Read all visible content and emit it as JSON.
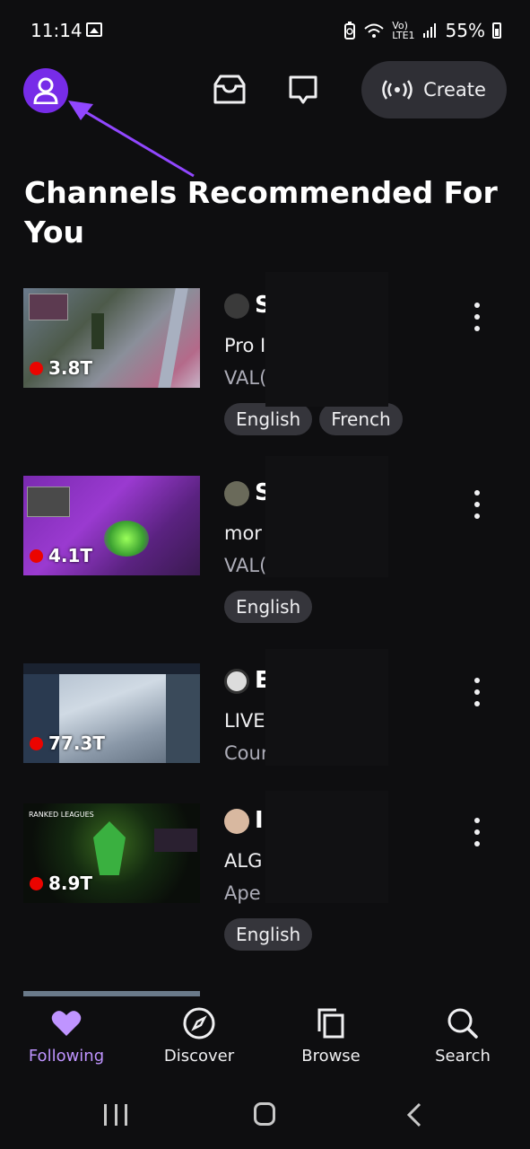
{
  "status_bar": {
    "time": "11:14",
    "network_top": "Vo)",
    "network_bottom": "LTE1",
    "battery": "55%"
  },
  "header": {
    "create_label": "Create"
  },
  "section_title": "Channels Recommended For You",
  "channels": [
    {
      "viewers": "3.8T",
      "name": "S",
      "title": "Pro I                    ER ...",
      "game": "VAL(",
      "tags": [
        "English",
        "French"
      ]
    },
    {
      "viewers": "4.1T",
      "name": "S",
      "title": "mor                     of r...",
      "game": "VAL(",
      "tags": [
        "English"
      ]
    },
    {
      "viewers": "77.3T",
      "name": "E                 )",
      "title": "LIVE                    vs ...",
      "game": "Cour                   Glo...",
      "tags": []
    },
    {
      "viewers": "8.9T",
      "name": "I",
      "title": "ALG                  TY L...",
      "game": "Ape",
      "tags": [
        "English"
      ],
      "thumb_caption": "RANKED LEAGUES"
    }
  ],
  "bottom_nav": [
    {
      "label": "Following",
      "icon": "heart-icon",
      "active": true
    },
    {
      "label": "Discover",
      "icon": "compass-icon",
      "active": false
    },
    {
      "label": "Browse",
      "icon": "browse-icon",
      "active": false
    },
    {
      "label": "Search",
      "icon": "search-icon",
      "active": false
    }
  ],
  "colors": {
    "accent": "#772ce8",
    "active_nav": "#bf94ff",
    "live": "#eb0400",
    "background": "#0e0e10"
  }
}
